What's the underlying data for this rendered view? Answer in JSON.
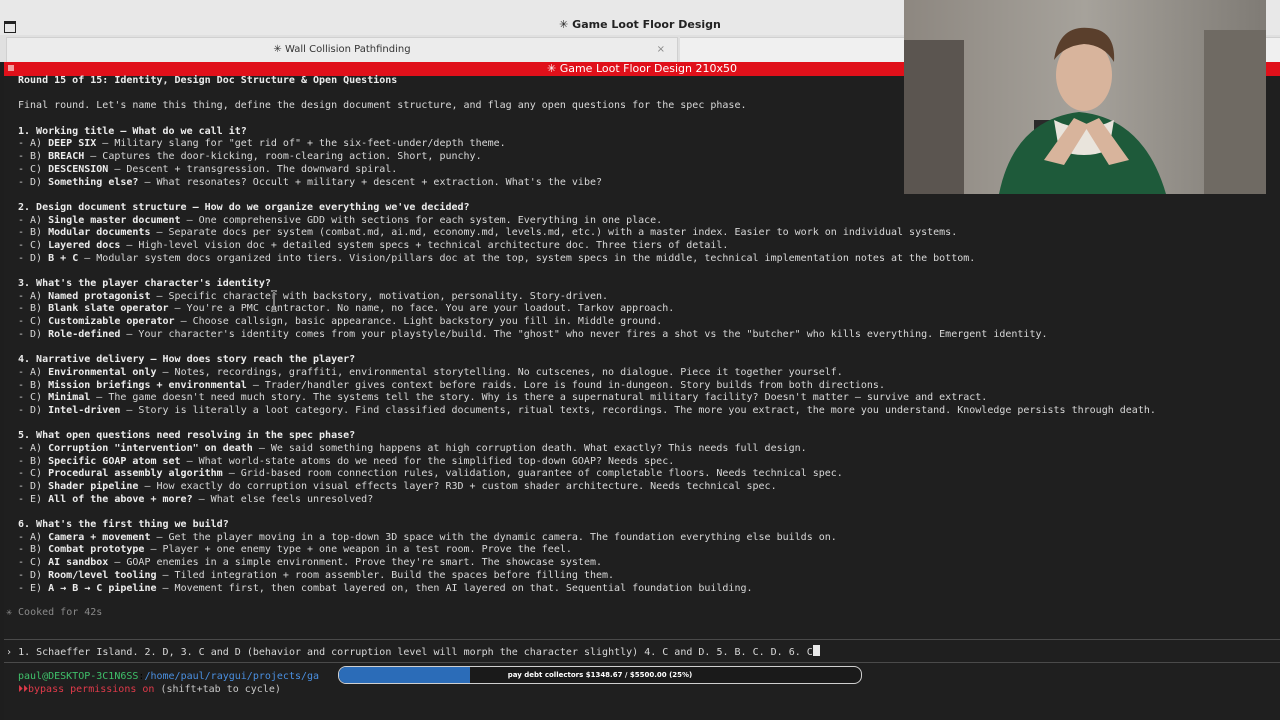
{
  "window": {
    "title": "✳ Game Loot Floor Design"
  },
  "tabs": [
    {
      "label": "✳ Wall Collision Pathfinding",
      "close": "×"
    }
  ],
  "session_title": "✳ Game Loot Floor Design 210x50",
  "content": {
    "round": "Round 15 of 15: Identity, Design Doc Structure & Open Questions",
    "intro": "Final round. Let's name this thing, define the design document structure, and flag any open questions for the spec phase.",
    "questions": [
      {
        "heading": "1. Working title — What do we call it?",
        "options": [
          {
            "prefix": "- A) ",
            "name": "DEEP SIX",
            "text": " — Military slang for \"get rid of\" + the six-feet-under/depth theme."
          },
          {
            "prefix": "- B) ",
            "name": "BREACH",
            "text": " — Captures the door-kicking, room-clearing action. Short, punchy."
          },
          {
            "prefix": "- C) ",
            "name": "DESCENSION",
            "text": " — Descent + transgression. The downward spiral."
          },
          {
            "prefix": "- D) ",
            "name": "Something else?",
            "text": " — What resonates? Occult + military + descent + extraction. What's the vibe?"
          }
        ]
      },
      {
        "heading": "2. Design document structure — How do we organize everything we've decided?",
        "options": [
          {
            "prefix": "- A) ",
            "name": "Single master document",
            "text": " — One comprehensive GDD with sections for each system. Everything in one place."
          },
          {
            "prefix": "- B) ",
            "name": "Modular documents",
            "text": " — Separate docs per system (combat.md, ai.md, economy.md, levels.md, etc.) with a master index. Easier to work on individual systems."
          },
          {
            "prefix": "- C) ",
            "name": "Layered docs",
            "text": " — High-level vision doc + detailed system specs + technical architecture doc. Three tiers of detail."
          },
          {
            "prefix": "- D) ",
            "name": "B + C",
            "text": " — Modular system docs organized into tiers. Vision/pillars doc at the top, system specs in the middle, technical implementation notes at the bottom."
          }
        ]
      },
      {
        "heading": "3. What's the player character's identity?",
        "options": [
          {
            "prefix": "- A) ",
            "name": "Named protagonist",
            "text": " — Specific character with backstory, motivation, personality. Story-driven."
          },
          {
            "prefix": "- B) ",
            "name": "Blank slate operator",
            "text": " — You're a PMC contractor. No name, no face. You are your loadout. Tarkov approach."
          },
          {
            "prefix": "- C) ",
            "name": "Customizable operator",
            "text": " — Choose callsign, basic appearance. Light backstory you fill in. Middle ground."
          },
          {
            "prefix": "- D) ",
            "name": "Role-defined",
            "text": " — Your character's identity comes from your playstyle/build. The \"ghost\" who never fires a shot vs the \"butcher\" who kills everything. Emergent identity."
          }
        ]
      },
      {
        "heading": "4. Narrative delivery — How does story reach the player?",
        "options": [
          {
            "prefix": "- A) ",
            "name": "Environmental only",
            "text": " — Notes, recordings, graffiti, environmental storytelling. No cutscenes, no dialogue. Piece it together yourself."
          },
          {
            "prefix": "- B) ",
            "name": "Mission briefings + environmental",
            "text": " — Trader/handler gives context before raids. Lore is found in-dungeon. Story builds from both directions."
          },
          {
            "prefix": "- C) ",
            "name": "Minimal",
            "text": " — The game doesn't need much story. The systems tell the story. Why is there a supernatural military facility? Doesn't matter — survive and extract."
          },
          {
            "prefix": "- D) ",
            "name": "Intel-driven",
            "text": " — Story is literally a loot category. Find classified documents, ritual texts, recordings. The more you extract, the more you understand. Knowledge persists through death."
          }
        ]
      },
      {
        "heading": "5. What open questions need resolving in the spec phase?",
        "options": [
          {
            "prefix": "- A) ",
            "name": "Corruption \"intervention\" on death",
            "text": " — We said something happens at high corruption death. What exactly? This needs full design."
          },
          {
            "prefix": "- B) ",
            "name": "Specific GOAP atom set",
            "text": " — What world-state atoms do we need for the simplified top-down GOAP? Needs spec."
          },
          {
            "prefix": "- C) ",
            "name": "Procedural assembly algorithm",
            "text": " — Grid-based room connection rules, validation, guarantee of completable floors. Needs technical spec."
          },
          {
            "prefix": "- D) ",
            "name": "Shader pipeline",
            "text": " — How exactly do corruption visual effects layer? R3D + custom shader architecture. Needs technical spec."
          },
          {
            "prefix": "- E) ",
            "name": "All of the above + more?",
            "text": " — What else feels unresolved?"
          }
        ]
      },
      {
        "heading": "6. What's the first thing we build?",
        "options": [
          {
            "prefix": "- A) ",
            "name": "Camera + movement",
            "text": " — Get the player moving in a top-down 3D space with the dynamic camera. The foundation everything else builds on."
          },
          {
            "prefix": "- B) ",
            "name": "Combat prototype",
            "text": " — Player + one enemy type + one weapon in a test room. Prove the feel."
          },
          {
            "prefix": "- C) ",
            "name": "AI sandbox",
            "text": " — GOAP enemies in a simple environment. Prove they're smart. The showcase system."
          },
          {
            "prefix": "- D) ",
            "name": "Room/level tooling",
            "text": " — Tiled integration + room assembler. Build the spaces before filling them."
          },
          {
            "prefix": "- E) ",
            "name": "A → B → C pipeline",
            "text": " — Movement first, then combat layered on, then AI layered on that. Sequential foundation building."
          }
        ]
      }
    ],
    "cooked": "✳ Cooked for 42s"
  },
  "prompt": {
    "symbol": "›",
    "input": "1. Schaeffer Island. 2. D, 3. C and D (behavior and corruption level will morph the character slightly) 4. C and D. 5. B. C. D. 6. C"
  },
  "shell": {
    "user": "paul@DESKTOP-3C1N6SS",
    "sep": ":",
    "path": "/home/paul/raygui/projects/ga"
  },
  "status": {
    "symbol": "⏵⏵",
    "bypass": "bypass permissions on",
    "hint": " (shift+tab to cycle)"
  },
  "progress": {
    "label": "pay debt collectors $1348.67 / $5500.00 (25%)",
    "fraction": 0.25,
    "fill_color": "#2b6cb8"
  },
  "colors": {
    "accent_red": "#e0101a",
    "terminal_bg": "#1f1f1f",
    "user_green": "#3fc06a",
    "path_blue": "#4a8fe0"
  }
}
